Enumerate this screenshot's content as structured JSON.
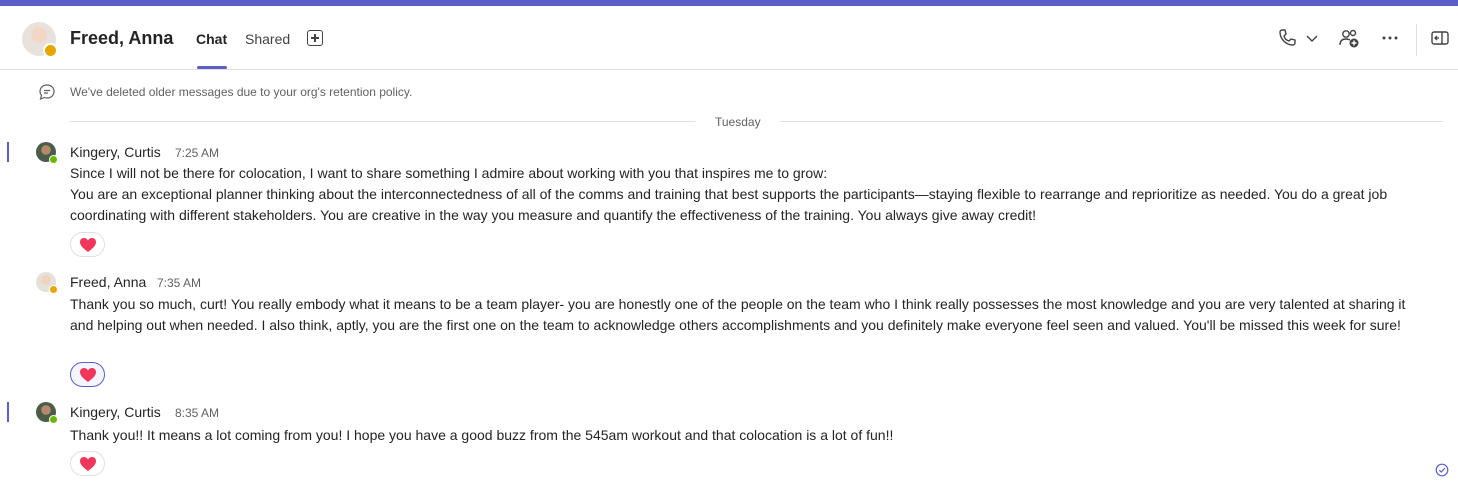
{
  "header": {
    "contact_name": "Freed, Anna",
    "tabs": [
      {
        "label": "Chat",
        "active": true
      },
      {
        "label": "Shared",
        "active": false
      }
    ],
    "icons": [
      "add-tab-icon",
      "phone-icon",
      "chevron-down-icon",
      "add-people-icon",
      "more-icon",
      "popout-icon"
    ]
  },
  "retention_notice": "We've deleted older messages due to your org's retention policy.",
  "day_divider": "Tuesday",
  "messages": [
    {
      "sender": "Kingery, Curtis",
      "time": "7:25 AM",
      "lines": [
        "Since I will not be there for colocation, I want to share something I admire about working with you that inspires me to grow:",
        "You are an exceptional planner thinking about the interconnectedness of all of the comms and training that best supports the participants—staying flexible to rearrange and reprioritize as needed. You do a great job coordinating with different stakeholders. You are creative in the way you measure and quantify the effectiveness of the training. You always give away credit!"
      ],
      "reaction": "heart"
    },
    {
      "sender": "Freed, Anna",
      "time": "7:35 AM",
      "lines": [
        "Thank you so much, curt! You really embody what it means to be a team player- you are honestly one of the people on the team who I think really possesses the most knowledge and you are very talented at sharing it and helping out when needed. I also think, aptly, you are the first one on the team to acknowledge others accomplishments and you definitely make everyone feel seen and valued. You'll be missed this week for sure!"
      ],
      "reaction": "heart"
    },
    {
      "sender": "Kingery, Curtis",
      "time": "8:35 AM",
      "lines": [
        "Thank you!! It means a lot coming from you! I hope you have a good buzz from the 545am workout and that colocation is a lot of fun!!"
      ],
      "reaction": "heart"
    }
  ],
  "colors": {
    "accent": "#5b5fc7",
    "online": "#6bb700",
    "away": "#e8a500",
    "heart": "#f0365a"
  }
}
